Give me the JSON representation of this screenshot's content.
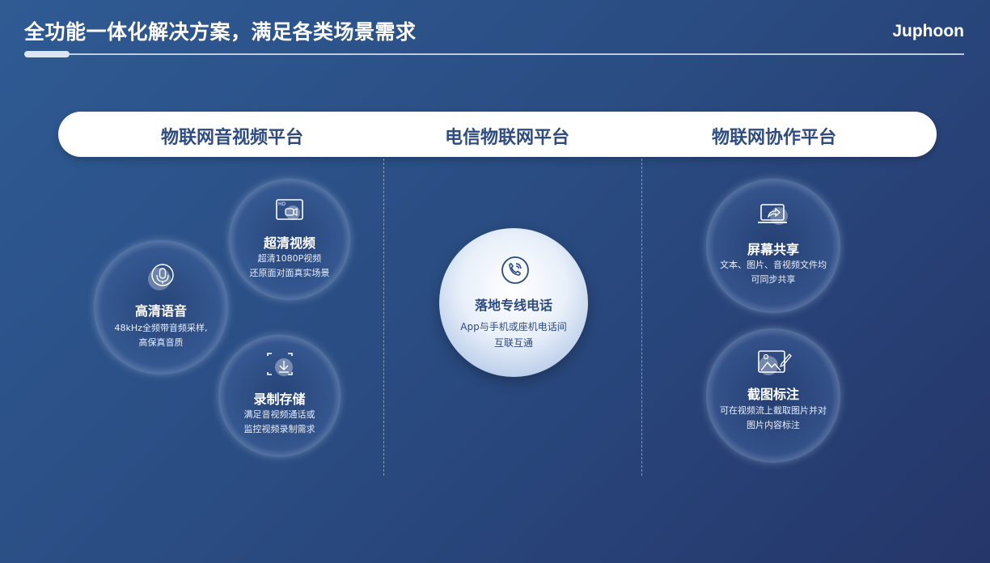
{
  "header": {
    "title": "全功能一体化解决方案，满足各类场景需求",
    "brand": "Juphoon"
  },
  "platforms": [
    {
      "label": "物联网音视频平台"
    },
    {
      "label": "电信物联网平台"
    },
    {
      "label": "物联网协作平台"
    }
  ],
  "features": {
    "hd_video": {
      "name": "超清视频",
      "line1": "超清1080P视频",
      "line2": "还原面对面真实场景",
      "icon": "hd-video-icon"
    },
    "hd_voice": {
      "name": "高清语音",
      "line1": "48kHz全频带音频采样,",
      "line2": "高保真音质",
      "icon": "microphone-icon"
    },
    "recording": {
      "name": "录制存储",
      "line1": "满足音视频通话或",
      "line2": "监控视频录制需求",
      "icon": "recording-icon"
    },
    "landline": {
      "name": "落地专线电话",
      "line1": "App与手机或座机电话间",
      "line2": "互联互通",
      "icon": "phone-call-icon"
    },
    "screen_share": {
      "name": "屏幕共享",
      "line1": "文本、图片、音视频文件均",
      "line2": "可同步共享",
      "icon": "screen-share-icon"
    },
    "screenshot": {
      "name": "截图标注",
      "line1": "可在视频流上截取图片并对",
      "line2": "图片内容标注",
      "icon": "image-annotate-icon"
    }
  },
  "colors": {
    "accent_dark": "#2e4c80",
    "bg_start": "#2f5a93",
    "bg_end": "#25366a"
  }
}
